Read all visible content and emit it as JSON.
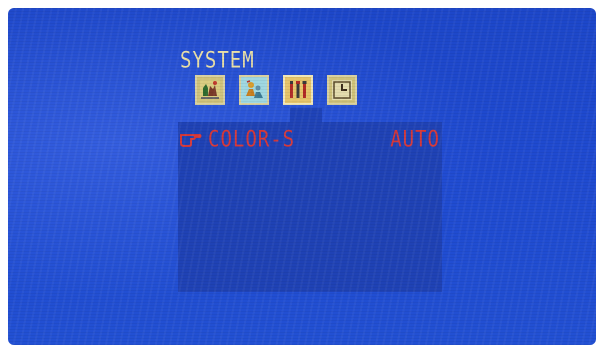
{
  "osd": {
    "title": "SYSTEM",
    "icons": [
      {
        "name": "picture-icon"
      },
      {
        "name": "people-icon"
      },
      {
        "name": "tools-icon",
        "selected": true
      },
      {
        "name": "clock-icon"
      }
    ],
    "menu": {
      "rows": [
        {
          "label": "COLOR-S",
          "value": "AUTO",
          "selected": true
        }
      ]
    }
  },
  "colors": {
    "background": "#1f4ad0",
    "panel": "#1f42b5",
    "title_text": "#e9dfa6",
    "menu_text": "#d6383a"
  }
}
